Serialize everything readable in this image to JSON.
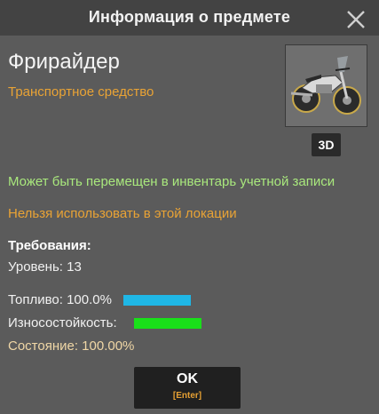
{
  "dialog": {
    "title": "Информация о предмете",
    "close_icon": "close-icon"
  },
  "item": {
    "name": "Фрирайдер",
    "type": "Транспортное средство",
    "image_icon": "motorcycle-icon",
    "view3d_label": "3D"
  },
  "messages": {
    "transferable": "Может быть перемещен в инвентарь учетной записи",
    "restricted": "Нельзя использовать в этой локации"
  },
  "requirements": {
    "title": "Требования:",
    "level": "Уровень: 13"
  },
  "stats": {
    "fuel": {
      "label": "Топливо: 100.0%",
      "fraction": 1.0,
      "color": "#1fb7e6"
    },
    "durability": {
      "label": "Износостойкость:",
      "fraction": 1.0,
      "color": "#19e019"
    },
    "condition": {
      "label": "Состояние: 100.00%"
    }
  },
  "actions": {
    "ok_label": "OK",
    "ok_hint": "[Enter]"
  },
  "colors": {
    "orange_accent": "#e9a335",
    "green_text": "#a9e87d",
    "panel": "#5b5b5b",
    "header": "#434343"
  }
}
